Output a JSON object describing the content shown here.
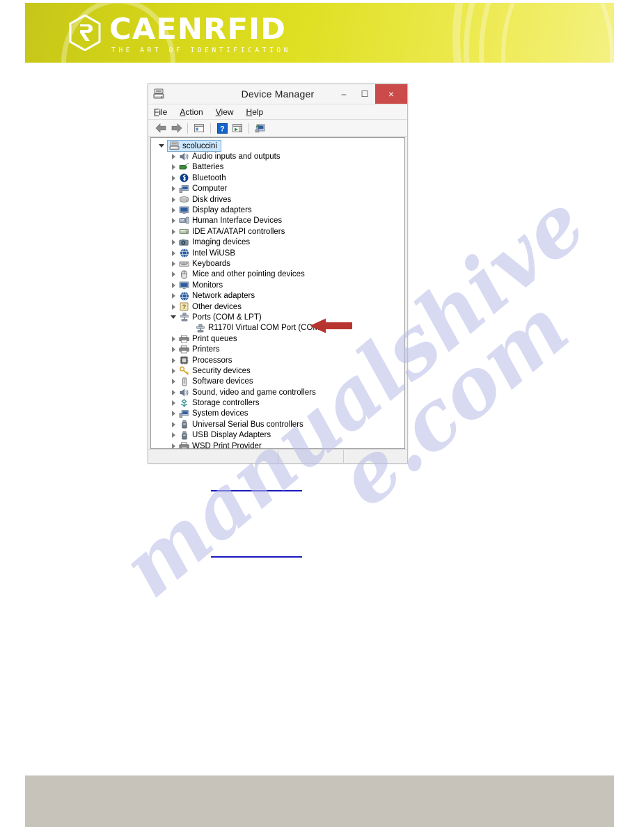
{
  "page": {
    "header": {
      "brand_name": "CAENRFID",
      "tagline": "THE ART OF IDENTIFICATION",
      "logo_icon": "hexagon-r-mark-icon",
      "gradient_from": "#c6c61a",
      "gradient_to": "#f4f183"
    },
    "watermark": {
      "text": "manualshive.com",
      "part_one": "manualshive",
      "part_two": "e.com",
      "color": "#b9bce8"
    },
    "footer": {
      "background": "#c7c3bb",
      "text": ""
    }
  },
  "window": {
    "title": "Device Manager",
    "title_icon": "device-manager-icon",
    "controls": {
      "minimize": "–",
      "maximize": "❐",
      "close": "×",
      "close_color": "#cb4a4a"
    },
    "menu": [
      {
        "pre": "",
        "acc": "F",
        "post": "ile"
      },
      {
        "pre": "",
        "acc": "A",
        "post": "ction"
      },
      {
        "pre": "",
        "acc": "V",
        "post": "iew"
      },
      {
        "pre": "",
        "acc": "H",
        "post": "elp"
      }
    ],
    "toolbar": [
      {
        "name": "back-arrow-icon",
        "glyph": "←"
      },
      {
        "name": "forward-arrow-icon",
        "glyph": "→"
      },
      {
        "name": "separator",
        "glyph": ""
      },
      {
        "name": "properties-icon",
        "glyph": ""
      },
      {
        "name": "separator",
        "glyph": ""
      },
      {
        "name": "help-icon",
        "glyph": "?"
      },
      {
        "name": "scan-hardware-changes-icon",
        "glyph": ""
      },
      {
        "name": "separator",
        "glyph": ""
      },
      {
        "name": "update-driver-icon",
        "glyph": ""
      }
    ],
    "status_bar": {
      "left": "",
      "middle": "",
      "right": ""
    }
  },
  "tree": {
    "root": {
      "label": "scoluccini",
      "icon": "computer-icon",
      "selected": true,
      "expanded": true
    },
    "items": [
      {
        "label": "Audio inputs and outputs",
        "icon": "speaker-icon",
        "level": 1,
        "expanded": false
      },
      {
        "label": "Batteries",
        "icon": "battery-icon",
        "level": 1,
        "expanded": false
      },
      {
        "label": "Bluetooth",
        "icon": "bluetooth-icon",
        "level": 1,
        "expanded": false
      },
      {
        "label": "Computer",
        "icon": "computer-icon",
        "level": 1,
        "expanded": false
      },
      {
        "label": "Disk drives",
        "icon": "disk-drive-icon",
        "level": 1,
        "expanded": false
      },
      {
        "label": "Display adapters",
        "icon": "monitor-icon",
        "level": 1,
        "expanded": false
      },
      {
        "label": "Human Interface Devices",
        "icon": "hid-icon",
        "level": 1,
        "expanded": false
      },
      {
        "label": "IDE ATA/ATAPI controllers",
        "icon": "ide-controller-icon",
        "level": 1,
        "expanded": false
      },
      {
        "label": "Imaging devices",
        "icon": "camera-icon",
        "level": 1,
        "expanded": false
      },
      {
        "label": "Intel WiUSB",
        "icon": "network-card-icon",
        "level": 1,
        "expanded": false
      },
      {
        "label": "Keyboards",
        "icon": "keyboard-icon",
        "level": 1,
        "expanded": false
      },
      {
        "label": "Mice and other pointing devices",
        "icon": "mouse-icon",
        "level": 1,
        "expanded": false
      },
      {
        "label": "Monitors",
        "icon": "monitor-icon",
        "level": 1,
        "expanded": false
      },
      {
        "label": "Network adapters",
        "icon": "network-card-icon",
        "level": 1,
        "expanded": false
      },
      {
        "label": "Other devices",
        "icon": "unknown-device-icon",
        "level": 1,
        "expanded": false
      },
      {
        "label": "Ports (COM & LPT)",
        "icon": "port-icon",
        "level": 1,
        "expanded": true
      },
      {
        "label": "R1170I Virtual COM Port  (COM4)",
        "icon": "port-icon",
        "level": 2,
        "expanded": null,
        "highlighted_by_arrow": true
      },
      {
        "label": "Print queues",
        "icon": "printer-icon",
        "level": 1,
        "expanded": false
      },
      {
        "label": "Printers",
        "icon": "printer-icon",
        "level": 1,
        "expanded": false
      },
      {
        "label": "Processors",
        "icon": "processor-icon",
        "level": 1,
        "expanded": false
      },
      {
        "label": "Security devices",
        "icon": "key-icon",
        "level": 1,
        "expanded": false
      },
      {
        "label": "Software devices",
        "icon": "software-device-icon",
        "level": 1,
        "expanded": false
      },
      {
        "label": "Sound, video and game controllers",
        "icon": "speaker-icon",
        "level": 1,
        "expanded": false
      },
      {
        "label": "Storage controllers",
        "icon": "storage-controller-icon",
        "level": 1,
        "expanded": false
      },
      {
        "label": "System devices",
        "icon": "computer-icon",
        "level": 1,
        "expanded": false
      },
      {
        "label": "Universal Serial Bus controllers",
        "icon": "usb-icon",
        "level": 1,
        "expanded": false
      },
      {
        "label": "USB Display Adapters",
        "icon": "usb-icon",
        "level": 1,
        "expanded": false
      },
      {
        "label": "WSD Print Provider",
        "icon": "printer-icon",
        "level": 1,
        "expanded": false
      }
    ]
  },
  "annotation": {
    "arrow": {
      "name": "red-callout-arrow",
      "color": "#b8352f",
      "points_to": "R1170I Virtual COM Port  (COM4)"
    },
    "rules": [
      {
        "name": "redacted-link-rule-1",
        "color": "#1919c0"
      },
      {
        "name": "redacted-link-rule-2",
        "color": "#1919c0"
      }
    ]
  }
}
